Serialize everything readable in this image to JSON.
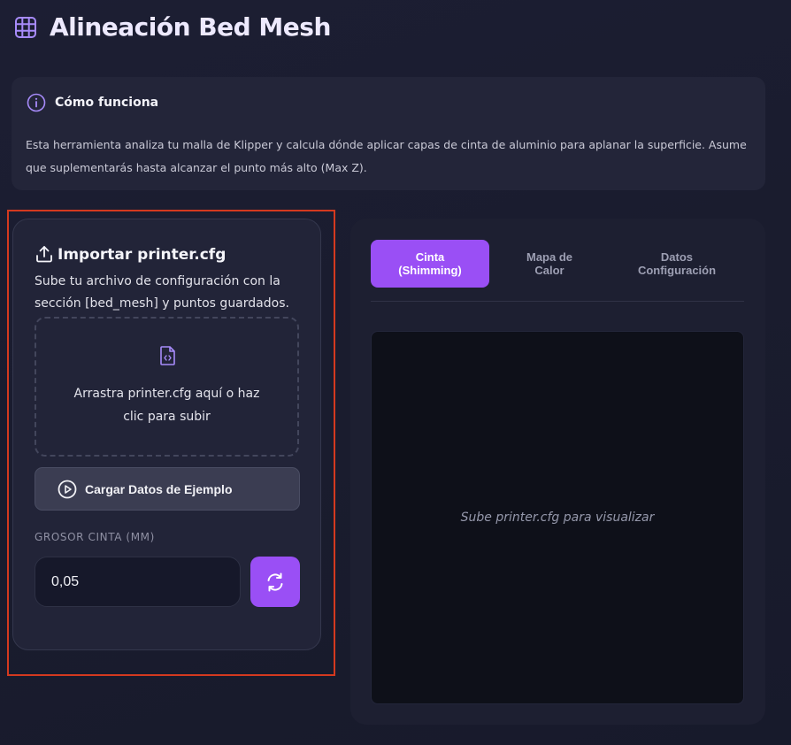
{
  "header": {
    "title": "Alineación Bed Mesh",
    "icon": "grid-icon"
  },
  "info": {
    "title": "Cómo funciona",
    "text": "Esta herramienta analiza tu malla de Klipper y calcula dónde aplicar capas de cinta de aluminio para aplanar la superficie. Asume que suplementarás hasta alcanzar el punto más alto (Max Z)."
  },
  "import_card": {
    "title": "Importar printer.cfg",
    "description": "Sube tu archivo de configuración con la sección [bed_mesh] y puntos guardados.",
    "dropzone_text": "Arrastra printer.cfg aquí o haz clic para subir",
    "sample_button": "Cargar Datos de Ejemplo",
    "thickness_label": "GROSOR CINTA (MM)",
    "thickness_value": "0,05"
  },
  "viewer": {
    "tabs": [
      {
        "line1": "Cinta",
        "line2": "(Shimming)"
      },
      {
        "line1": "Mapa de",
        "line2": "Calor"
      },
      {
        "line1": "Datos",
        "line2": "Configuración"
      }
    ],
    "placeholder": "Sube printer.cfg para visualizar"
  },
  "colors": {
    "accent": "#9a4ff5",
    "highlight_border": "#d4391f",
    "background": "#1c1e33"
  }
}
